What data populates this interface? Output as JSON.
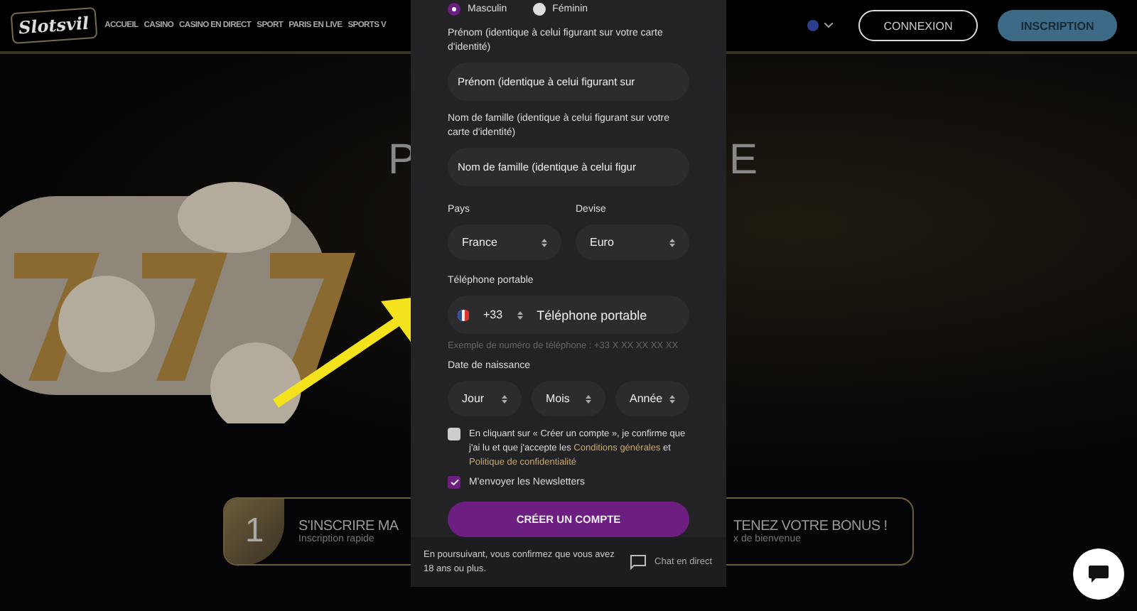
{
  "header": {
    "logo": "Slotsvil",
    "nav": [
      "ACCUEIL",
      "CASINO",
      "CASINO EN DIRECT",
      "SPORT",
      "PARIS EN LIVE",
      "SPORTS V"
    ],
    "login": "CONNEXION",
    "signup": "INSCRIPTION"
  },
  "hero": {
    "title_left": "P",
    "title_right": "E"
  },
  "steps": [
    {
      "number": "1",
      "title": "S'INSCRIRE MA",
      "subtitle": "Inscription rapide"
    },
    {
      "title": "TENEZ VOTRE BONUS !",
      "subtitle": "x de bienvenue"
    }
  ],
  "form": {
    "gender": [
      {
        "label": "Masculin",
        "selected": true
      },
      {
        "label": "Féminin",
        "selected": false
      }
    ],
    "first_name": {
      "label": "Prénom (identique à celui figurant sur votre carte d'identité)",
      "placeholder": "Prénom (identique à celui figurant sur"
    },
    "last_name": {
      "label": "Nom de famille (identique à celui figurant sur votre carte d'identité)",
      "placeholder": "Nom de famille (identique à celui figur"
    },
    "country": {
      "label": "Pays",
      "value": "France"
    },
    "currency": {
      "label": "Devise",
      "value": "Euro"
    },
    "phone": {
      "label": "Téléphone portable",
      "code": "+33",
      "placeholder": "Téléphone portable",
      "hint": "Exemple de numéro de téléphone : +33 X XX XX XX XX"
    },
    "birth": {
      "label": "Date de naissance",
      "selects": [
        "Jour",
        "Mois",
        "Année"
      ]
    },
    "terms": {
      "checked": false,
      "text": "En cliquant sur « Créer un compte », je confirme que j'ai lu et que j'accepte les ",
      "link1": "Conditions générales",
      "between": " et ",
      "link2": "Politique de confidentialité"
    },
    "newsletter": {
      "checked": true,
      "text": "M'envoyer les Newsletters"
    },
    "submit": "CRÉER UN COMPTE",
    "footer_note": "En poursuivant, vous confirmez que vous avez 18 ans ou plus.",
    "chat": "Chat en direct"
  }
}
